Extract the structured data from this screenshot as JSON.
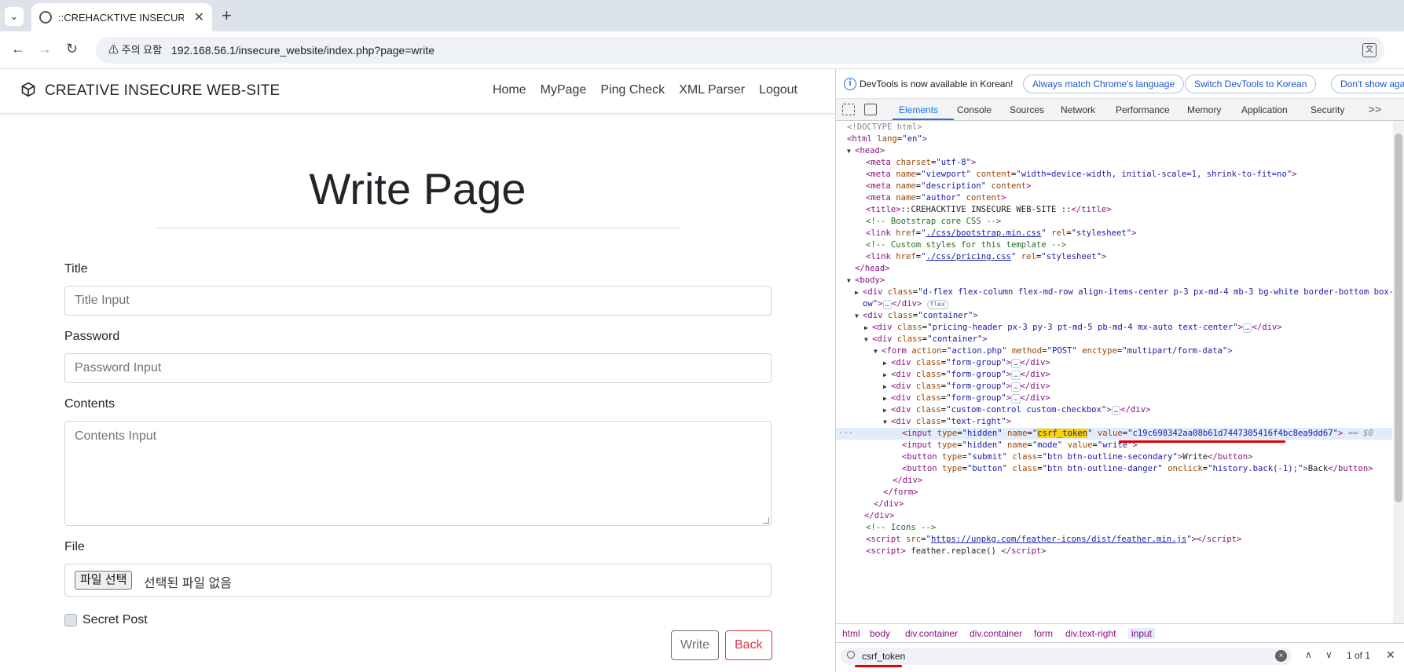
{
  "browser": {
    "tab_title": "::CREHACKTIVE INSECURE WEB-SITE ::",
    "security_chip": "주의 요함",
    "url": "192.168.56.1/insecure_website/index.php?page=write"
  },
  "site": {
    "brand": "CREATIVE INSECURE WEB-SITE",
    "nav": [
      "Home",
      "MyPage",
      "Ping Check",
      "XML Parser",
      "Logout"
    ],
    "heading": "Write Page",
    "form": {
      "title_label": "Title",
      "title_placeholder": "Title Input",
      "password_label": "Password",
      "password_placeholder": "Password Input",
      "contents_label": "Contents",
      "contents_placeholder": "Contents Input",
      "file_label": "File",
      "file_button": "파일 선택",
      "file_status": "선택된 파일 없음",
      "secret_label": "Secret Post",
      "write_button": "Write",
      "back_button": "Back"
    }
  },
  "devtools": {
    "info_text": "DevTools is now available in Korean!",
    "info_buttons": [
      "Always match Chrome's language",
      "Switch DevTools to Korean",
      "Don't show aga"
    ],
    "tabs": [
      "Elements",
      "Console",
      "Sources",
      "Network",
      "Performance",
      "Memory",
      "Application",
      "Security"
    ],
    "more_tabs": ">>",
    "breadcrumbs": [
      "html",
      "body",
      "div.container",
      "div.container",
      "form",
      "div.text-right",
      "input"
    ],
    "search_value": "csrf_token",
    "search_count": "1 of 1",
    "search_clear": "×",
    "search_close": "✕",
    "csrf_value": "c19c698342aa08b61d7447305416f4bc8ea9dd67"
  }
}
